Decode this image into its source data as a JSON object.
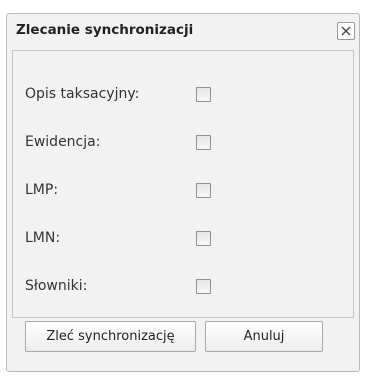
{
  "dialog": {
    "title": "Zlecanie synchronizacji",
    "close_icon": "close-icon"
  },
  "form": {
    "rows": [
      {
        "label": "Opis taksacyjny:",
        "checked": false
      },
      {
        "label": "Ewidencja:",
        "checked": false
      },
      {
        "label": "LMP:",
        "checked": false
      },
      {
        "label": "LMN:",
        "checked": false
      },
      {
        "label": "Słowniki:",
        "checked": false
      }
    ]
  },
  "buttons": {
    "submit_label": "Zleć synchronizację",
    "cancel_label": "Anuluj"
  }
}
